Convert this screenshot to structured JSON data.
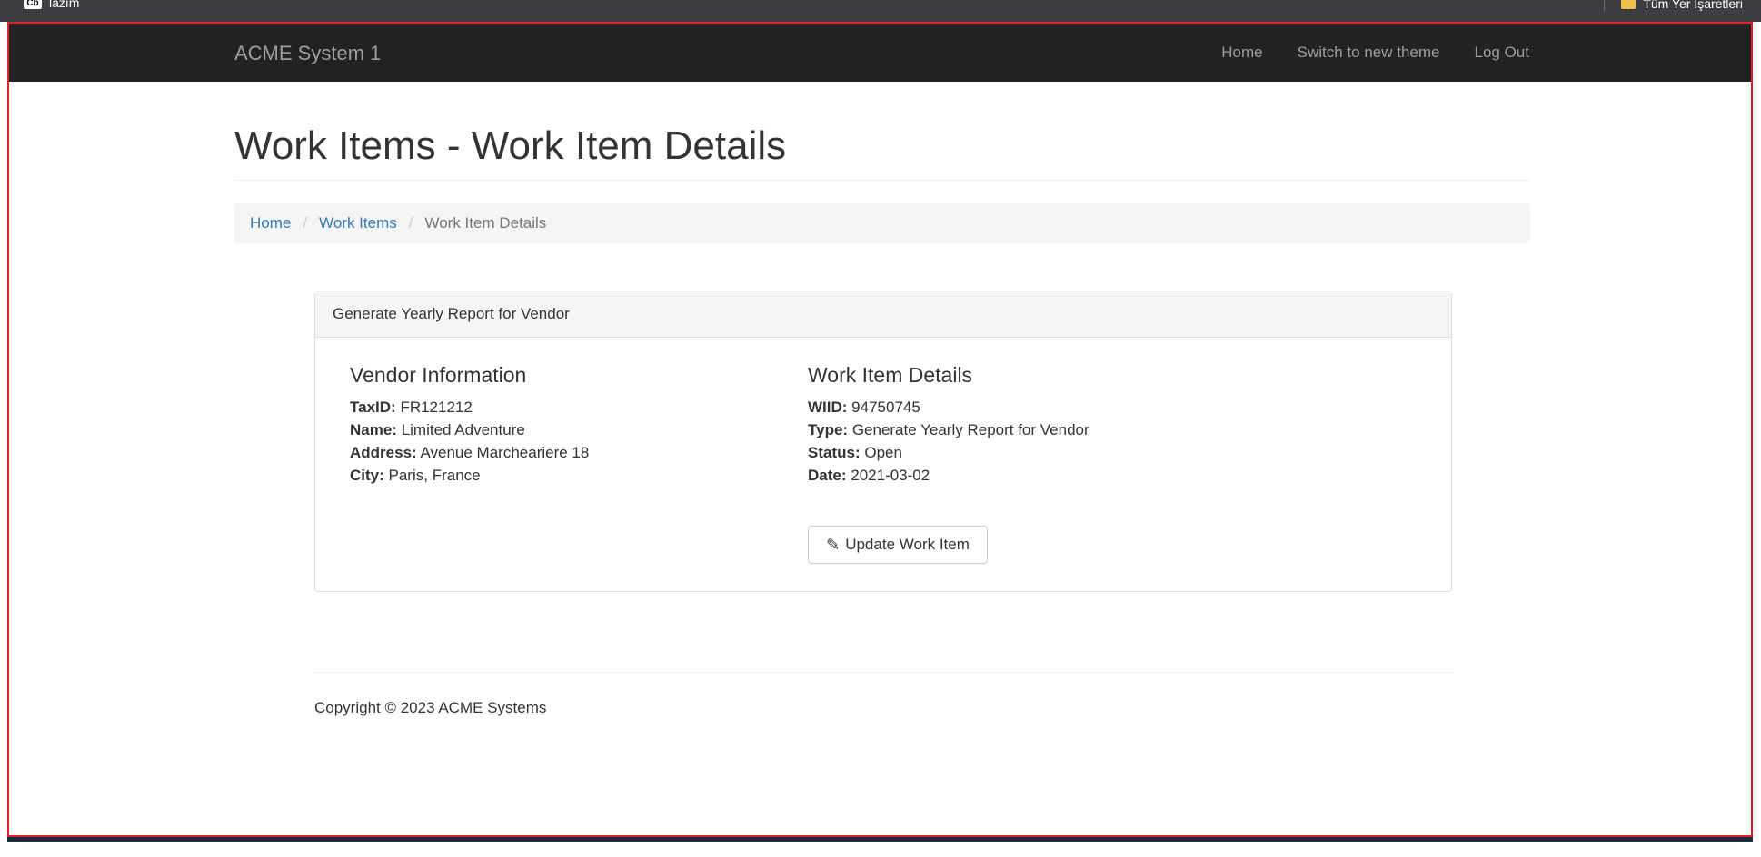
{
  "browser": {
    "bookmark_left_icon": "Cb",
    "bookmark_left_label": "lazım",
    "bookmark_right_label": "Tüm Yer İşaretleri"
  },
  "navbar": {
    "brand": "ACME System 1",
    "links": [
      "Home",
      "Switch to new theme",
      "Log Out"
    ]
  },
  "page": {
    "title": "Work Items - Work Item Details"
  },
  "breadcrumb": {
    "items": [
      "Home",
      "Work Items",
      "Work Item Details"
    ],
    "divider": "/"
  },
  "panel": {
    "heading": "Generate Yearly Report for Vendor",
    "vendor": {
      "title": "Vendor Information",
      "fields": [
        {
          "label": "TaxID:",
          "value": "FR121212"
        },
        {
          "label": "Name:",
          "value": "Limited Adventure"
        },
        {
          "label": "Address:",
          "value": "Avenue Marcheariere 18"
        },
        {
          "label": "City:",
          "value": "Paris, France"
        }
      ]
    },
    "details": {
      "title": "Work Item Details",
      "fields": [
        {
          "label": "WIID:",
          "value": "94750745"
        },
        {
          "label": "Type:",
          "value": "Generate Yearly Report for Vendor"
        },
        {
          "label": "Status:",
          "value": "Open"
        },
        {
          "label": "Date:",
          "value": "2021-03-02"
        }
      ]
    },
    "update_button": "Update Work Item"
  },
  "footer": {
    "copyright": "Copyright © 2023 ACME Systems"
  },
  "colors": {
    "navbar_bg": "#222222",
    "link": "#337ab7",
    "frame_outline": "#e0232b"
  }
}
